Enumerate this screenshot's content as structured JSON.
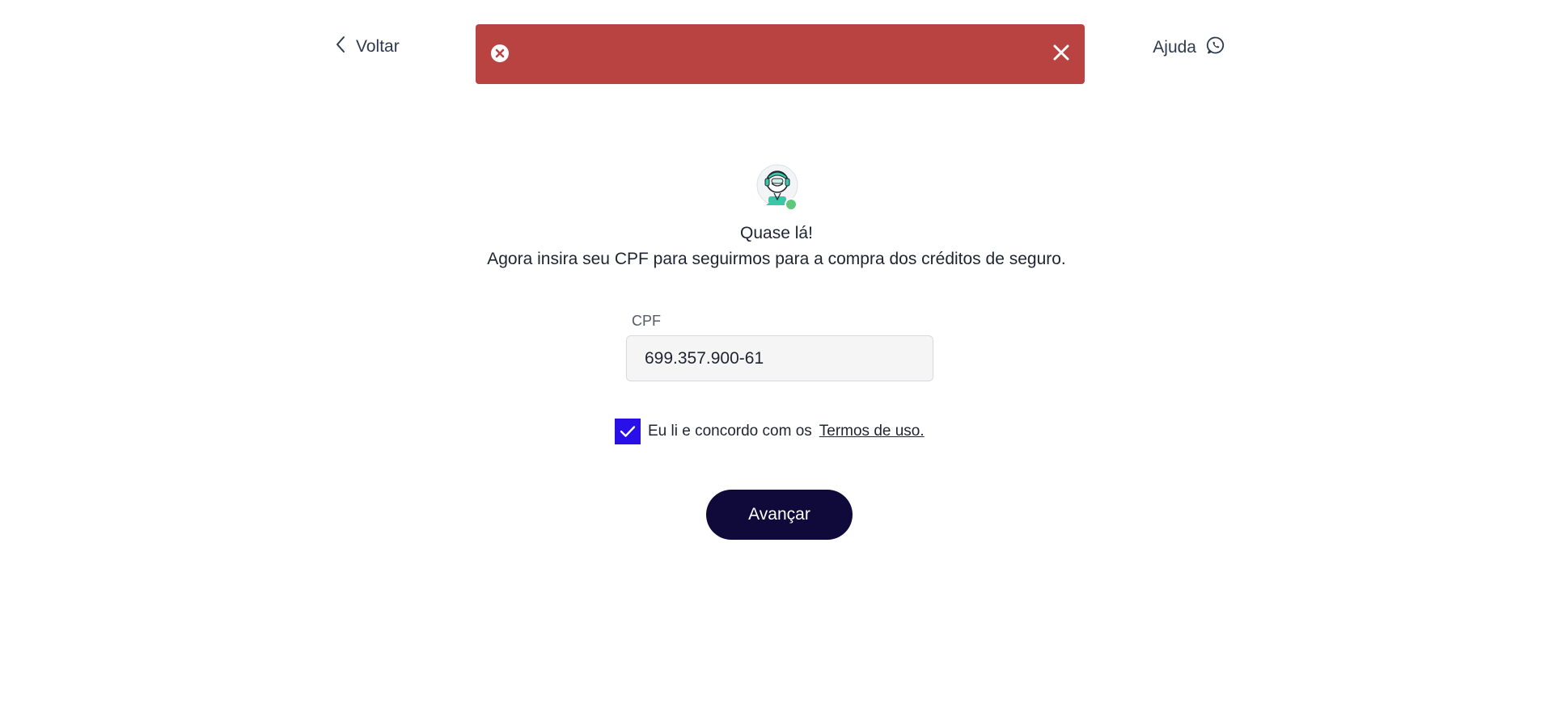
{
  "header": {
    "back_label": "Voltar",
    "help_label": "Ajuda"
  },
  "toast": {
    "color": "#b94340",
    "icon": "error-circle-icon",
    "close_icon": "close-icon"
  },
  "main": {
    "title": "Quase lá!",
    "subtitle": "Agora insira seu CPF para seguirmos para a compra dos créditos de seguro."
  },
  "form": {
    "cpf_label": "CPF",
    "cpf_value": "699.357.900-61",
    "terms_checked": true,
    "terms_text": "Eu li e concordo com os",
    "terms_link": "Termos de uso.",
    "submit_label": "Avançar"
  },
  "colors": {
    "primary": "#100a3a",
    "checkbox": "#2a10e8",
    "toast_error": "#b94340",
    "status_online": "#5cc97a"
  }
}
